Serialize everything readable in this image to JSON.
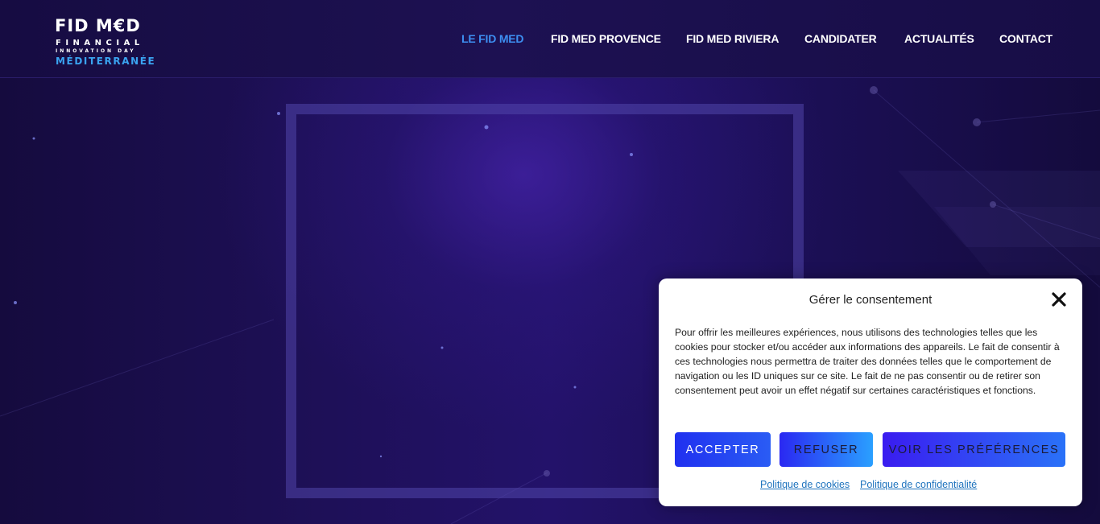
{
  "brand": {
    "logo_title": "FID M€D",
    "logo_line1": "FINANCIAL",
    "logo_line2": "INNOVATION DAY",
    "logo_line3": "MÉDITERRANÉE",
    "accent_color": "#3aa3f0"
  },
  "nav": {
    "items": [
      {
        "label": "LE FID MED",
        "active": true
      },
      {
        "label": "FID MED PROVENCE",
        "active": false
      },
      {
        "label": "FID MED RIVIERA",
        "active": false
      },
      {
        "label": "CANDIDATER",
        "active": false
      },
      {
        "label": "ACTUALITÉS",
        "active": false
      },
      {
        "label": "CONTACT",
        "active": false
      }
    ],
    "active_color": "#3d8ff2"
  },
  "consent": {
    "title": "Gérer le consentement",
    "close_icon": "close-icon",
    "body": "Pour offrir les meilleures expériences, nous utilisons des technologies telles que les cookies pour stocker et/ou accéder aux informations des appareils. Le fait de consentir à ces technologies nous permettra de traiter des données telles que le comportement de navigation ou les ID uniques sur ce site. Le fait de ne pas consentir ou de retirer son consentement peut avoir un effet négatif sur certaines caractéristiques et fonctions.",
    "accept_label": "ACCEPTER",
    "refuse_label": "REFUSER",
    "preferences_label": "VOIR LES PRÉFÉRENCES",
    "cookie_policy_link": "Politique de cookies",
    "privacy_policy_link": "Politique de confidentialité"
  }
}
